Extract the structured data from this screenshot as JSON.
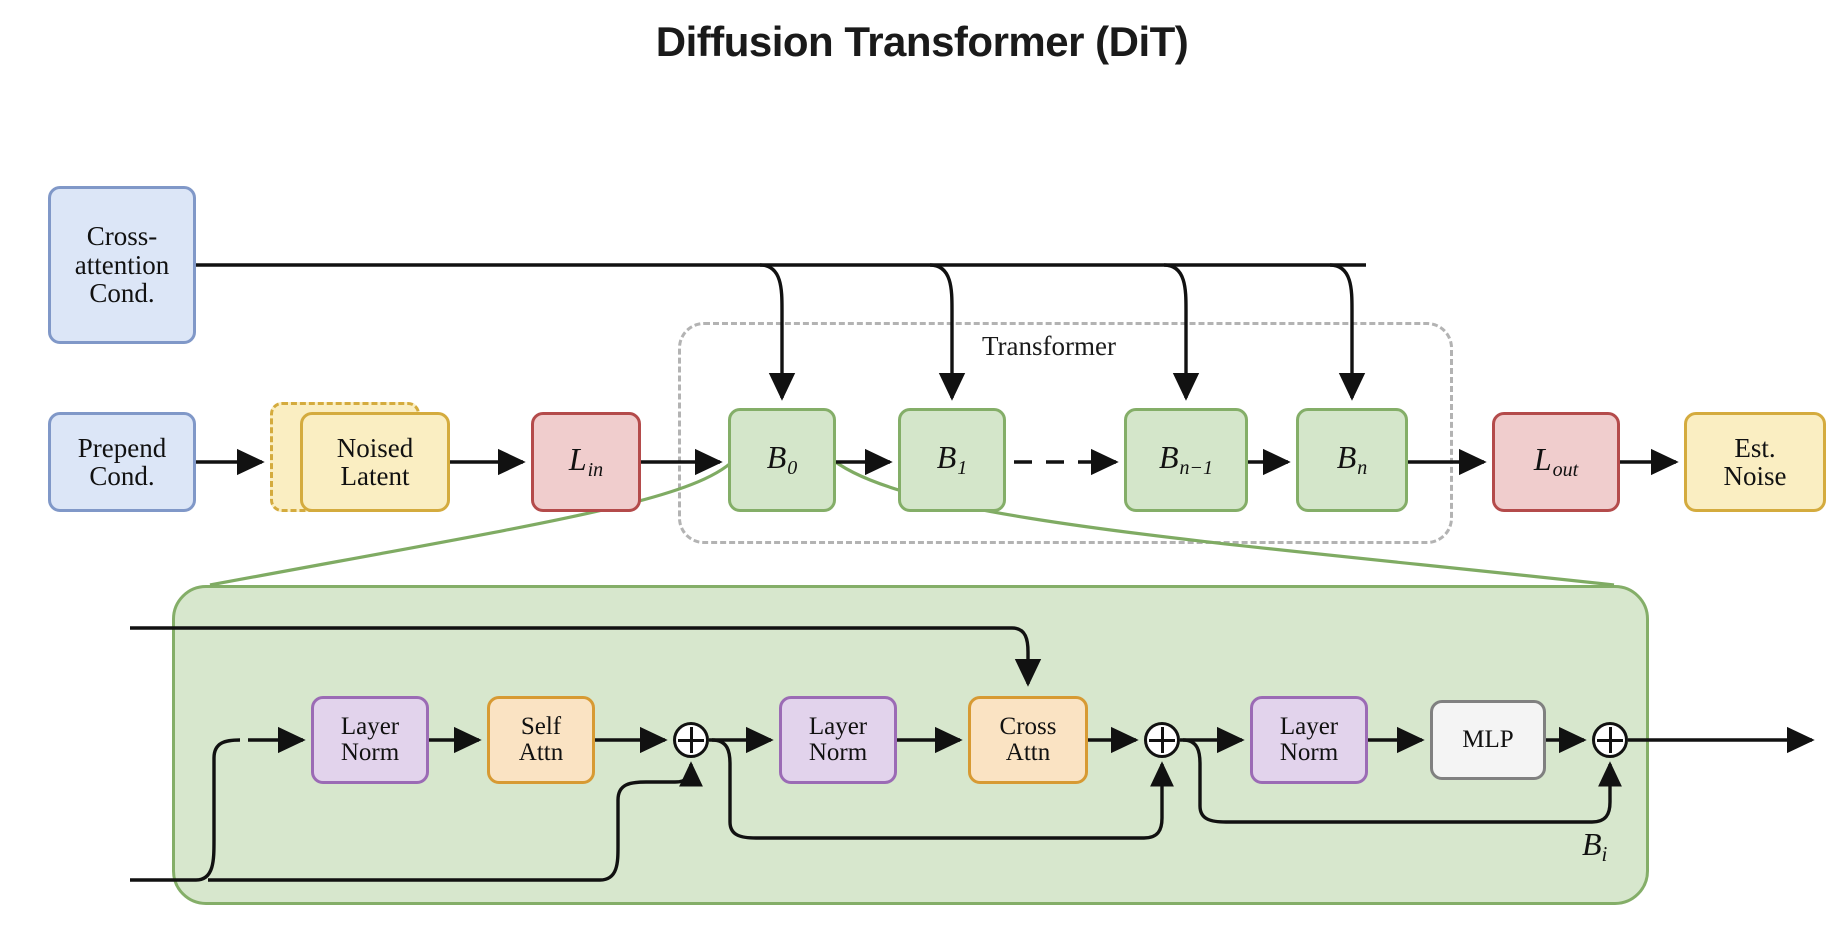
{
  "figure": {
    "title": "Diffusion Transformer (DiT)",
    "group_label": "Transformer",
    "detail_label": "B",
    "detail_label_sub": "i"
  },
  "colors": {
    "blue_fill": "#dce6f7",
    "blue_border": "#8098c8",
    "yellow_fill": "#faeec2",
    "yellow_border": "#d4ab3e",
    "red_fill": "#f0cdcd",
    "red_border": "#b44b4b",
    "green_fill": "#d4e6ca",
    "green_border": "#84ae68",
    "purple_fill": "#e2d3ec",
    "purple_border": "#9b6bb5",
    "orange_fill": "#fae3c3",
    "orange_border": "#d79a33",
    "grey_fill": "#f4f4f4",
    "grey_border": "#808080",
    "group_dash": "#b3b3b3",
    "wire": "#111111"
  },
  "top_level": {
    "cross_attention_cond": {
      "line1": "Cross-",
      "line2": "attention",
      "line3": "Cond."
    },
    "prepend_cond": {
      "line1": "Prepend",
      "line2": "Cond."
    },
    "noised_latent": {
      "line1": "Noised",
      "line2": "Latent"
    },
    "l_in": {
      "base": "L",
      "sub": "in"
    },
    "blocks": [
      {
        "base": "B",
        "sub": "0"
      },
      {
        "base": "B",
        "sub": "1"
      },
      {
        "base": "B",
        "sub": "n−1"
      },
      {
        "base": "B",
        "sub": "n"
      }
    ],
    "l_out": {
      "base": "L",
      "sub": "out"
    },
    "est_noise": {
      "line1": "Est.",
      "line2": "Noise"
    }
  },
  "block_detail": {
    "layer_norm_1": {
      "line1": "Layer",
      "line2": "Norm"
    },
    "self_attn": {
      "line1": "Self",
      "line2": "Attn"
    },
    "layer_norm_2": {
      "line1": "Layer",
      "line2": "Norm"
    },
    "cross_attn": {
      "line1": "Cross",
      "line2": "Attn"
    },
    "layer_norm_3": {
      "line1": "Layer",
      "line2": "Norm"
    },
    "mlp": {
      "line1": "MLP"
    },
    "adders": [
      "⊕",
      "⊕",
      "⊕"
    ]
  },
  "chart_data": {
    "type": "diagram",
    "title": "Diffusion Transformer (DiT)",
    "nodes": [
      {
        "id": "cross_attn_cond",
        "label": "Cross-attention Cond.",
        "color": "#dce6f7",
        "row": "top"
      },
      {
        "id": "prepend_cond",
        "label": "Prepend Cond.",
        "color": "#dce6f7",
        "row": "main"
      },
      {
        "id": "noised_latent_ghost",
        "label": "",
        "color": "#faeec2",
        "row": "main",
        "style": "dashed"
      },
      {
        "id": "noised_latent",
        "label": "Noised Latent",
        "color": "#faeec2",
        "row": "main"
      },
      {
        "id": "l_in",
        "label": "L_in",
        "color": "#f0cdcd",
        "row": "main"
      },
      {
        "id": "b0",
        "label": "B_0",
        "color": "#d4e6ca",
        "row": "main"
      },
      {
        "id": "b1",
        "label": "B_1",
        "color": "#d4e6ca",
        "row": "main"
      },
      {
        "id": "bn1",
        "label": "B_{n-1}",
        "color": "#d4e6ca",
        "row": "main"
      },
      {
        "id": "bn",
        "label": "B_n",
        "color": "#d4e6ca",
        "row": "main"
      },
      {
        "id": "l_out",
        "label": "L_out",
        "color": "#f0cdcd",
        "row": "main"
      },
      {
        "id": "est_noise",
        "label": "Est. Noise",
        "color": "#faeec2",
        "row": "main"
      },
      {
        "id": "ln1",
        "label": "Layer Norm",
        "color": "#e2d3ec",
        "row": "detail"
      },
      {
        "id": "selfattn",
        "label": "Self Attn",
        "color": "#fae3c3",
        "row": "detail"
      },
      {
        "id": "add1",
        "label": "⊕",
        "row": "detail"
      },
      {
        "id": "ln2",
        "label": "Layer Norm",
        "color": "#e2d3ec",
        "row": "detail"
      },
      {
        "id": "crossattn",
        "label": "Cross Attn",
        "color": "#fae3c3",
        "row": "detail"
      },
      {
        "id": "add2",
        "label": "⊕",
        "row": "detail"
      },
      {
        "id": "ln3",
        "label": "Layer Norm",
        "color": "#e2d3ec",
        "row": "detail"
      },
      {
        "id": "mlp",
        "label": "MLP",
        "color": "#f4f4f4",
        "row": "detail"
      },
      {
        "id": "add3",
        "label": "⊕",
        "row": "detail"
      }
    ],
    "edges": [
      {
        "from": "prepend_cond",
        "to": "noised_latent"
      },
      {
        "from": "noised_latent",
        "to": "l_in"
      },
      {
        "from": "l_in",
        "to": "b0"
      },
      {
        "from": "b0",
        "to": "b1"
      },
      {
        "from": "b1",
        "to": "bn1",
        "style": "dashed"
      },
      {
        "from": "bn1",
        "to": "bn"
      },
      {
        "from": "bn",
        "to": "l_out"
      },
      {
        "from": "l_out",
        "to": "est_noise"
      },
      {
        "from": "cross_attn_cond",
        "to": "b0"
      },
      {
        "from": "cross_attn_cond",
        "to": "b1"
      },
      {
        "from": "cross_attn_cond",
        "to": "bn1"
      },
      {
        "from": "cross_attn_cond",
        "to": "bn"
      },
      {
        "from": "ln1",
        "to": "selfattn"
      },
      {
        "from": "selfattn",
        "to": "add1"
      },
      {
        "from": "add1",
        "to": "ln2"
      },
      {
        "from": "ln2",
        "to": "crossattn"
      },
      {
        "from": "crossattn",
        "to": "add2"
      },
      {
        "from": "add2",
        "to": "ln3"
      },
      {
        "from": "ln3",
        "to": "mlp"
      },
      {
        "from": "mlp",
        "to": "add3"
      }
    ],
    "groups": [
      {
        "label": "Transformer",
        "members": [
          "b0",
          "b1",
          "bn1",
          "bn"
        ],
        "style": "dashed"
      },
      {
        "label": "B_i",
        "members": [
          "ln1",
          "selfattn",
          "add1",
          "ln2",
          "crossattn",
          "add2",
          "ln3",
          "mlp",
          "add3"
        ],
        "style": "solid-green"
      }
    ]
  }
}
